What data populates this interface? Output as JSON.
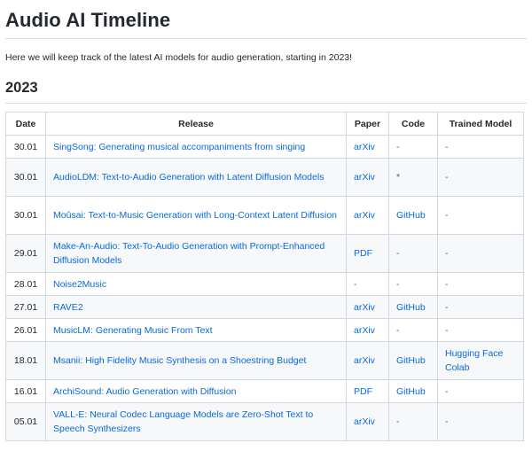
{
  "page": {
    "title": "Audio AI Timeline",
    "intro": "Here we will keep track of the latest AI models for audio generation, starting in 2023!",
    "section_title": "2023"
  },
  "table": {
    "headers": {
      "date": "Date",
      "release": "Release",
      "paper": "Paper",
      "code": "Code",
      "model": "Trained Model"
    },
    "rows": [
      {
        "date": "30.01",
        "release": "SingSong: Generating musical accompaniments from singing",
        "paper": "arXiv",
        "code": "-",
        "model": "-",
        "model2": ""
      },
      {
        "date": "30.01",
        "release": "AudioLDM: Text-to-Audio Generation with Latent Diffusion Models",
        "paper": "arXiv",
        "code": "*",
        "model": "-",
        "model2": ""
      },
      {
        "date": "30.01",
        "release": "Moûsai: Text-to-Music Generation with Long-Context Latent Diffusion",
        "paper": "arXiv",
        "code": "GitHub",
        "model": "-",
        "model2": ""
      },
      {
        "date": "29.01",
        "release": "Make-An-Audio: Text-To-Audio Generation with Prompt-Enhanced Diffusion Models",
        "paper": "PDF",
        "code": "-",
        "model": "-",
        "model2": ""
      },
      {
        "date": "28.01",
        "release": "Noise2Music",
        "paper": "-",
        "code": "-",
        "model": "-",
        "model2": ""
      },
      {
        "date": "27.01",
        "release": "RAVE2",
        "paper": "arXiv",
        "code": "GitHub",
        "model": "-",
        "model2": ""
      },
      {
        "date": "26.01",
        "release": "MusicLM: Generating Music From Text",
        "paper": "arXiv",
        "code": "-",
        "model": "-",
        "model2": ""
      },
      {
        "date": "18.01",
        "release": "Msanii: High Fidelity Music Synthesis on a Shoestring Budget",
        "paper": "arXiv",
        "code": "GitHub",
        "model": "Hugging Face",
        "model2": "Colab"
      },
      {
        "date": "16.01",
        "release": "ArchiSound: Audio Generation with Diffusion",
        "paper": "PDF",
        "code": "GitHub",
        "model": "-",
        "model2": ""
      },
      {
        "date": "05.01",
        "release": "VALL-E: Neural Codec Language Models are Zero-Shot Text to Speech Synthesizers",
        "paper": "arXiv",
        "code": "-",
        "model": "-",
        "model2": ""
      }
    ]
  },
  "colors": {
    "link": "#0969da",
    "text": "#24292f",
    "border": "#d0d7de",
    "stripe": "#f6f8fa"
  }
}
